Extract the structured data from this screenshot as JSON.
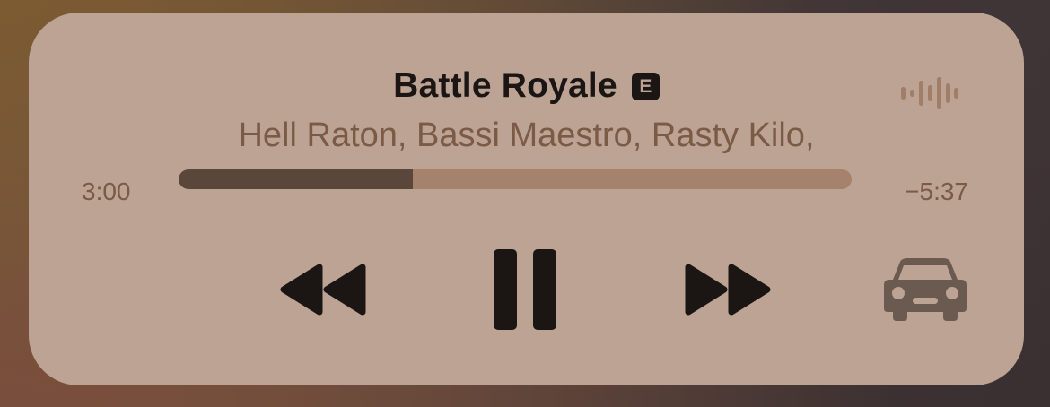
{
  "now_playing": {
    "title": "Battle Royale",
    "explicit_badge": "E",
    "artists": "Hell Raton, Bassi Maestro, Rasty Kilo,"
  },
  "progress": {
    "elapsed": "3:00",
    "remaining": "−5:37",
    "fraction": 0.348
  },
  "controls": {
    "rewind_icon": "backward-icon",
    "pause_icon": "pause-icon",
    "forward_icon": "forward-icon",
    "output_icon": "car-icon",
    "waveform_icon": "waveform-icon"
  },
  "colors": {
    "card_background": "#bca393",
    "primary_text": "#1b1614",
    "secondary_text": "#7b5a46",
    "progress_fill": "#5b463b",
    "progress_track": "#a5826b",
    "muted_icon": "#6b5a50"
  }
}
